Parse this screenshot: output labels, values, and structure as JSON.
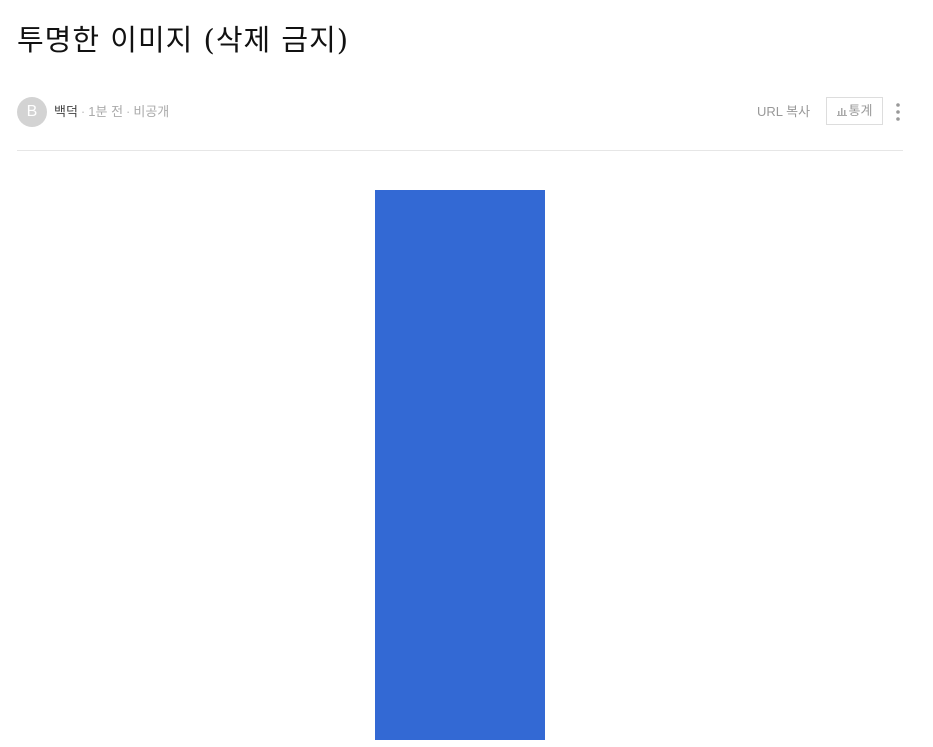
{
  "post": {
    "title": "투명한 이미지 (삭제 금지)"
  },
  "meta": {
    "avatar_letter": "B",
    "author": "백덕",
    "separator": "·",
    "time": "1분 전",
    "visibility": "비공개"
  },
  "actions": {
    "url_copy_label": "URL 복사",
    "stats_label": "통계",
    "stats_icon": "bar-chart-icon",
    "more_icon": "vertical-ellipsis-icon"
  },
  "colors": {
    "image_fill": "#3369d4",
    "avatar_bg": "#d3d3d3",
    "divider": "#e6e6e6"
  }
}
